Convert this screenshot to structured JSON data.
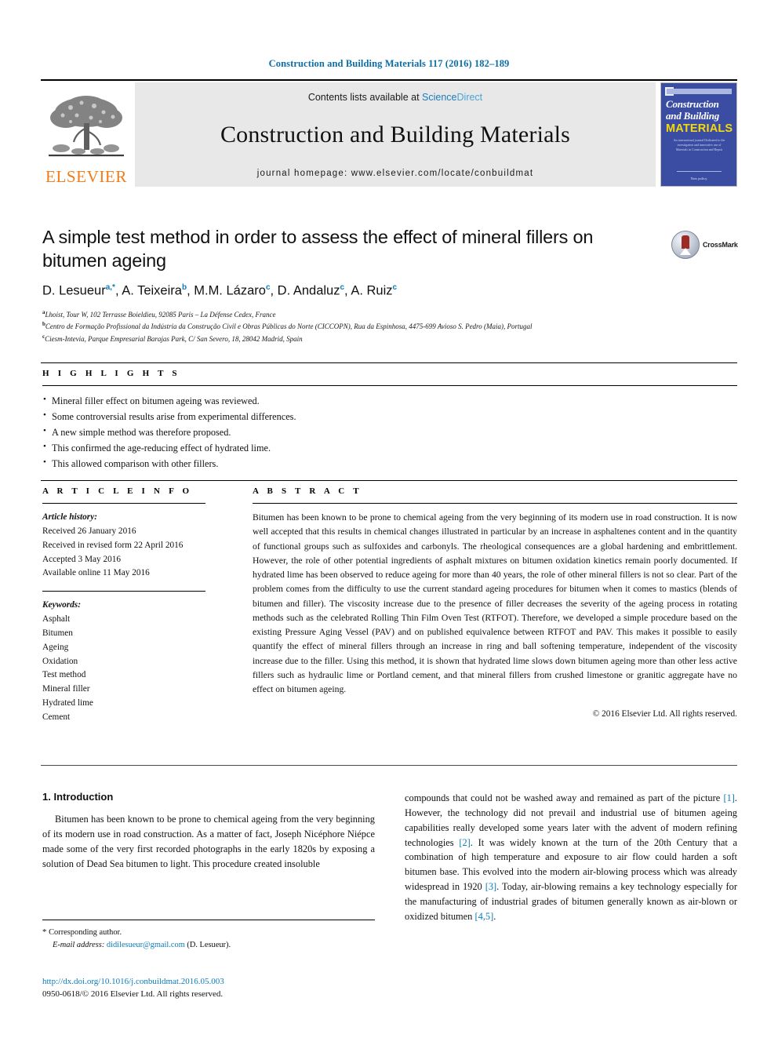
{
  "running_head": "Construction and Building Materials 117 (2016) 182–189",
  "masthead": {
    "publisher_name": "ELSEVIER",
    "contents_prefix": "Contents lists available at ",
    "contents_link_a": "Science",
    "contents_link_b": "Direct",
    "journal_name": "Construction and Building Materials",
    "homepage_line": "journal homepage: www.elsevier.com/locate/conbuildmat",
    "cover": {
      "line1": "Construction",
      "line2": "and Building",
      "line3": "MATERIALS",
      "blurb": "An international journal Dedicated to the investigation and innovative use of Materials in Construction and Repair",
      "footer": "Now policy"
    }
  },
  "title": "A simple test method in order to assess the effect of mineral fillers on bitumen ageing",
  "crossmark_label": "CrossMark",
  "authors": [
    {
      "name": "D. Lesueur",
      "sup": "a,*"
    },
    {
      "name": "A. Teixeira",
      "sup": "b"
    },
    {
      "name": "M.M. Lázaro",
      "sup": "c"
    },
    {
      "name": "D. Andaluz",
      "sup": "c"
    },
    {
      "name": "A. Ruiz",
      "sup": "c"
    }
  ],
  "affiliations": [
    {
      "marker": "a",
      "text": "Lhoist, Tour W, 102 Terrasse Boieldieu, 92085 Paris – La Défense Cedex, France"
    },
    {
      "marker": "b",
      "text": "Centro de Formação Profissional da Indústria da Construção Civil e Obras Públicas do Norte (CICCOPN), Rua da Espinhosa, 4475-699 Avioso S. Pedro (Maia), Portugal"
    },
    {
      "marker": "c",
      "text": "Ciesm-Intevia, Parque Empresarial Barajas Park, C/ San Severo, 18, 28042 Madrid, Spain"
    }
  ],
  "highlights": {
    "label": "H I G H L I G H T S",
    "items": [
      "Mineral filler effect on bitumen ageing was reviewed.",
      "Some controversial results arise from experimental differences.",
      "A new simple method was therefore proposed.",
      "This confirmed the age-reducing effect of hydrated lime.",
      "This allowed comparison with other fillers."
    ]
  },
  "article_info": {
    "label": "A R T I C L E   I N F O",
    "history_heading": "Article history:",
    "history": [
      "Received 26 January 2016",
      "Received in revised form 22 April 2016",
      "Accepted 3 May 2016",
      "Available online 11 May 2016"
    ],
    "keywords_heading": "Keywords:",
    "keywords": [
      "Asphalt",
      "Bitumen",
      "Ageing",
      "Oxidation",
      "Test method",
      "Mineral filler",
      "Hydrated lime",
      "Cement"
    ]
  },
  "abstract": {
    "label": "A B S T R A C T",
    "text": "Bitumen has been known to be prone to chemical ageing from the very beginning of its modern use in road construction. It is now well accepted that this results in chemical changes illustrated in particular by an increase in asphaltenes content and in the quantity of functional groups such as sulfoxides and carbonyls. The rheological consequences are a global hardening and embrittlement. However, the role of other potential ingredients of asphalt mixtures on bitumen oxidation kinetics remain poorly documented. If hydrated lime has been observed to reduce ageing for more than 40 years, the role of other mineral fillers is not so clear. Part of the problem comes from the difficulty to use the current standard ageing procedures for bitumen when it comes to mastics (blends of bitumen and filler). The viscosity increase due to the presence of filler decreases the severity of the ageing process in rotating methods such as the celebrated Rolling Thin Film Oven Test (RTFOT). Therefore, we developed a simple procedure based on the existing Pressure Aging Vessel (PAV) and on published equivalence between RTFOT and PAV. This makes it possible to easily quantify the effect of mineral fillers through an increase in ring and ball softening temperature, independent of the viscosity increase due to the filler. Using this method, it is shown that hydrated lime slows down bitumen ageing more than other less active fillers such as hydraulic lime or Portland cement, and that mineral fillers from crushed limestone or granitic aggregate have no effect on bitumen ageing.",
    "copyright": "© 2016 Elsevier Ltd. All rights reserved."
  },
  "introduction": {
    "heading": "1. Introduction",
    "left_paragraph": "Bitumen has been known to be prone to chemical ageing from the very beginning of its modern use in road construction. As a matter of fact, Joseph Nicéphore Niépce made some of the very first recorded photographs in the early 1820s by exposing a solution of Dead Sea bitumen to light. This procedure created insoluble",
    "right_paragraph_parts": [
      "compounds that could not be washed away and remained as part of the picture ",
      "[1]",
      ". However, the technology did not prevail and industrial use of bitumen ageing capabilities really developed some years later with the advent of modern refining technologies ",
      "[2]",
      ". It was widely known at the turn of the 20th Century that a combination of high temperature and exposure to air flow could harden a soft bitumen base. This evolved into the modern air-blowing process which was already widespread in 1920 ",
      "[3]",
      ". Today, air-blowing remains a key technology especially for the manufacturing of industrial grades of bitumen generally known as air-blown or oxidized bitumen ",
      "[4,5]",
      "."
    ]
  },
  "footnotes": {
    "corresponding": "Corresponding author.",
    "email_label": "E-mail address:",
    "email": "didilesueur@gmail.com",
    "email_suffix": "(D. Lesueur).",
    "doi": "http://dx.doi.org/10.1016/j.conbuildmat.2016.05.003",
    "issn_line": "0950-0618/© 2016 Elsevier Ltd. All rights reserved."
  }
}
